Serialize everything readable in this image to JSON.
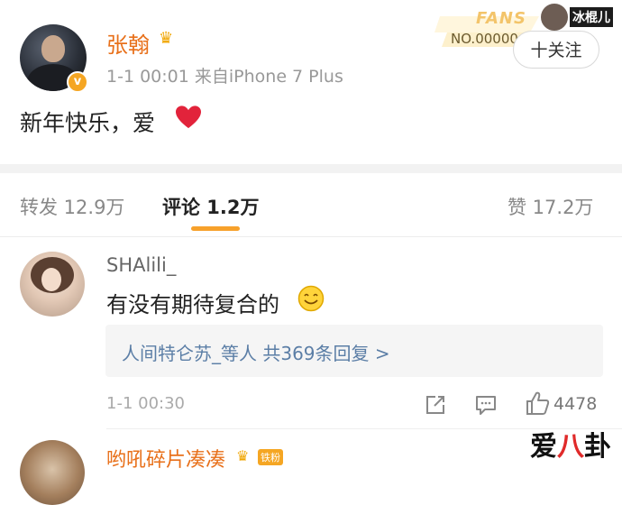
{
  "post": {
    "username": "张翰",
    "time": "1-1 00:01",
    "source": "来自iPhone 7 Plus",
    "text": "新年快乐，爱",
    "verified_badge": "v",
    "crown_icon": "crown-icon",
    "heart_icon": "heart-icon"
  },
  "fans": {
    "title": "FANS",
    "number": "NO.00000",
    "label": "冰棍儿"
  },
  "follow": {
    "label": "十关注"
  },
  "stats": {
    "repost": "转发 12.9万",
    "comments": "评论 1.2万",
    "likes": "赞 17.2万",
    "active_tab": "comments",
    "accent_color": "#f7a12b"
  },
  "comment": {
    "username": "SHAlili_",
    "text": "有没有期待复合的",
    "emoji": "smiley-icon",
    "replies": "人间特仑苏_等人 共369条回复 >",
    "time": "1-1 00:30",
    "like_count": "4478"
  },
  "next_comment": {
    "username": "哟吼碎片凑凑",
    "badge": "铁粉"
  },
  "watermark": {
    "part1": "爱",
    "part2": "八",
    "part3": "卦"
  }
}
